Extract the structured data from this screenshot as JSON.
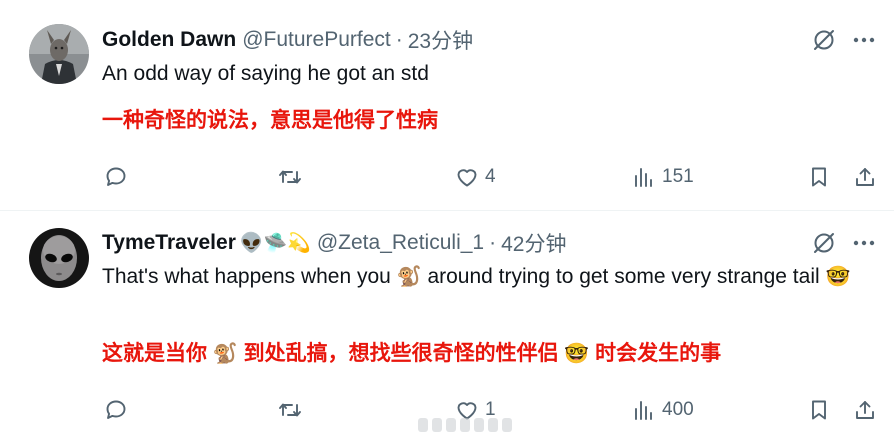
{
  "tweets": [
    {
      "author": "Golden Dawn",
      "handle": "@FuturePurfect",
      "separator": "·",
      "time": "23分钟",
      "text": "An odd way of saying he got an std",
      "translation": "一种奇怪的说法，意思是他得了性病",
      "likes": "4",
      "views": "151"
    },
    {
      "author": "TymeTraveler",
      "author_emojis": "👽🛸💫",
      "handle": "@Zeta_Reticuli_1",
      "separator": "·",
      "time": "42分钟",
      "text_before": "That's what happens when you ",
      "emoji_monkey": "🐒",
      "text_after": " around trying to get some very strange tail ",
      "emoji_nerd": "🤓",
      "translation_a": "这就是当你 ",
      "translation_b": " 到处乱搞，想找些很奇怪的性伴侣 ",
      "translation_c": " 时会发生的事",
      "likes": "1",
      "views": "400"
    }
  ],
  "colors": {
    "text": "#0f1419",
    "secondary": "#536471",
    "translation": "#e8160c",
    "divider": "#eff3f4"
  },
  "icons": [
    "reply-icon",
    "retweet-icon",
    "like-icon",
    "views-icon",
    "bookmark-icon",
    "share-icon",
    "grok-icon",
    "more-icon"
  ]
}
